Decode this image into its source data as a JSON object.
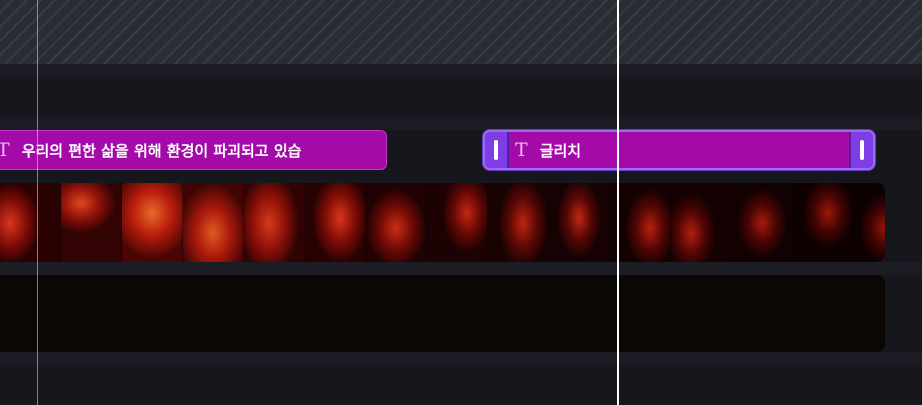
{
  "timeline": {
    "text_clips": [
      {
        "label": "우리의 편한 삶을 위해 환경이 파괴되고 있습",
        "icon": "text-icon",
        "icon_glyph": "T",
        "color": "#a40aa8",
        "selected": false
      },
      {
        "label": "글리치",
        "icon": "text-icon",
        "icon_glyph": "T",
        "color": "#a40aa8",
        "selected": true
      }
    ],
    "selection_color": "#7e3ee6",
    "playhead_color": "#ffffff"
  }
}
